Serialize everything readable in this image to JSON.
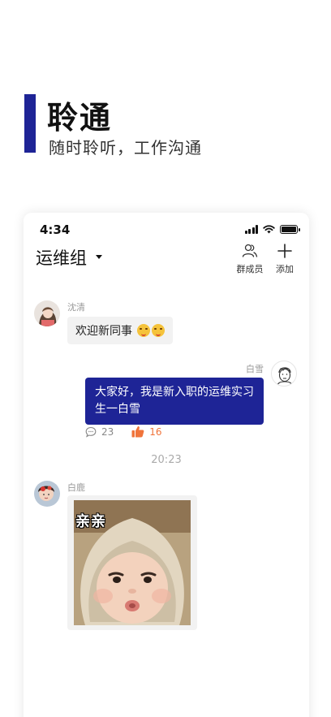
{
  "hero": {
    "title": "聆通",
    "subtitle": "随时聆听，工作沟通"
  },
  "status_bar": {
    "time": "4:34"
  },
  "header": {
    "group_name": "运维组",
    "members_label": "群成员",
    "add_label": "添加"
  },
  "messages": [
    {
      "sender": "沈清",
      "text": "欢迎新同事",
      "emojis": [
        "smiling-face-emoji",
        "smiling-face-emoji"
      ]
    },
    {
      "sender": "白雪",
      "text": "大家好，我是新入职的运维实习生一白雪",
      "comment_count": "23",
      "like_count": "16"
    },
    {
      "sender": "白鹿",
      "sticker_caption": "亲亲"
    }
  ],
  "timestamp": "20:23",
  "colors": {
    "accent": "#1e2496",
    "like": "#f0743b",
    "bubble_grey": "#f2f2f2"
  }
}
